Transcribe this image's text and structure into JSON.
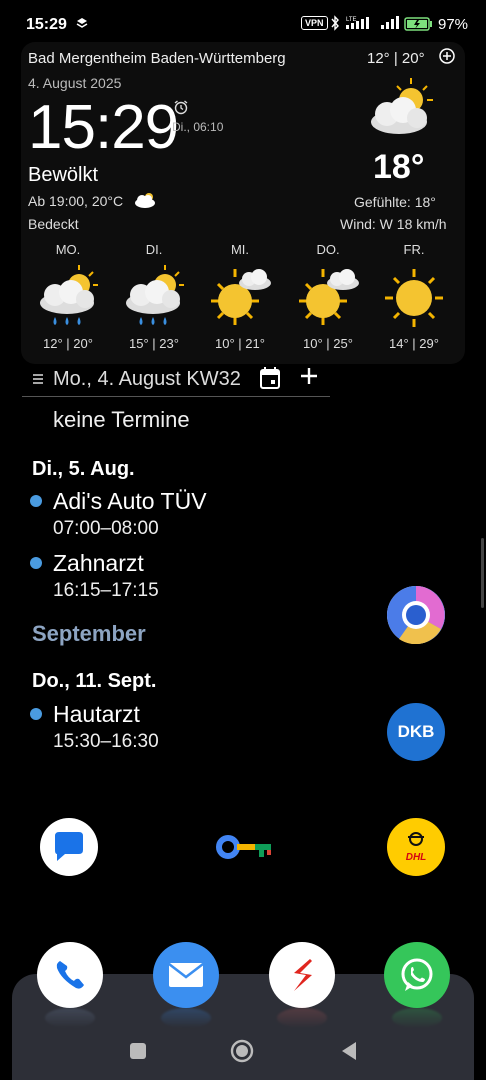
{
  "status_bar": {
    "time": "15:29",
    "vpn": "VPN",
    "battery_percent": "97%"
  },
  "weather": {
    "location": "Bad Mergentheim Baden-Württemberg",
    "today_range": "12° | 20°",
    "date": "4. August 2025",
    "clock": "15:29",
    "next_alarm": "Di., 06:10",
    "condition": "Bewölkt",
    "from_text": "Ab 19:00, 20°C",
    "description": "Bedeckt",
    "temperature": "18°",
    "feels_like": "Gefühlte: 18°",
    "wind": "Wind: W 18 km/h",
    "forecast": [
      {
        "day": "MO.",
        "range": "12° | 20°",
        "icon": "rain-sun-icon"
      },
      {
        "day": "DI.",
        "range": "15° | 23°",
        "icon": "rain-sun-icon"
      },
      {
        "day": "MI.",
        "range": "10° | 21°",
        "icon": "sun-cloud-icon"
      },
      {
        "day": "DO.",
        "range": "10° | 25°",
        "icon": "sun-cloud-icon"
      },
      {
        "day": "FR.",
        "range": "14° | 29°",
        "icon": "sun-icon"
      }
    ]
  },
  "calendar": {
    "header_date": "Mo., 4. August KW32",
    "today_empty": "keine Termine",
    "days": [
      {
        "header": "Di., 5. Aug.",
        "events": [
          {
            "title": "Adi's Auto TÜV",
            "time": "07:00–08:00"
          },
          {
            "title": "Zahnarzt",
            "time": "16:15–17:15"
          }
        ]
      }
    ],
    "month_header": "September",
    "days2": [
      {
        "header": "Do., 11. Sept.",
        "events": [
          {
            "title": "Hautarzt",
            "time": "15:30–16:30"
          }
        ]
      }
    ]
  },
  "apps": {
    "dkb_label": "DKB",
    "dhl_label": "DHL"
  },
  "colors": {
    "event_dot": "#4a9be0",
    "month_header": "#8da4c2",
    "dock": "#2d2f37"
  }
}
